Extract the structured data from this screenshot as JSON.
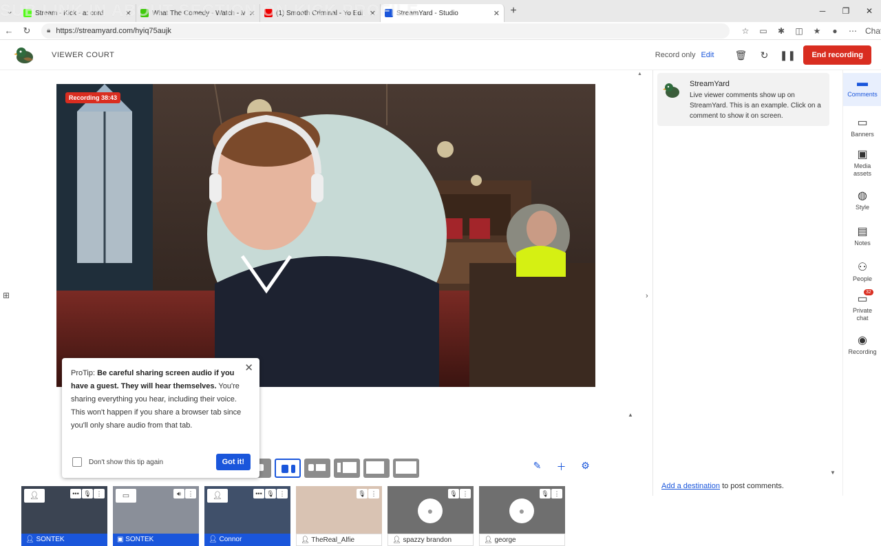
{
  "browser": {
    "tabs": [
      {
        "title": "Stream - Kick - a: cord",
        "color": "#53fc18"
      },
      {
        "title": "What The Comedy - Watch - Me",
        "color": "#3ec90a"
      },
      {
        "title": "(1) Smooth Criminal - Yo Edi",
        "color": "#e00"
      },
      {
        "title": "StreamYard - Studio",
        "color": "#1a56db",
        "active": true
      }
    ],
    "new_tab": "+",
    "url": "https://streamyard.com/hyiq75aujk",
    "chat_label": "Chat",
    "overlay_text": "SUB LINK IN ABOUT SECTION ON KICK PROFILE"
  },
  "header": {
    "studio_name": "VIEWER COURT",
    "record_only": "Record only",
    "edit": "Edit",
    "end_recording": "End recording"
  },
  "stage": {
    "recording_badge": "Recording 38:43"
  },
  "protip": {
    "prefix": "ProTip: ",
    "bold": "Be careful sharing screen audio if you have a guest. They will hear themselves.",
    "body": " You're sharing everything you hear, including their voice. This won't happen if you share a browser tab since you'll only share audio from that tab.",
    "checkbox_label": "Don't show this tip again",
    "button": "Got it!"
  },
  "tiles": [
    {
      "name": "SONTEK",
      "on_stage": true,
      "kind": "camera"
    },
    {
      "name": "SONTEK",
      "on_stage": true,
      "kind": "screen"
    },
    {
      "name": "Connor",
      "on_stage": true,
      "kind": "camera"
    },
    {
      "name": "TheReal_Alfie",
      "on_stage": false,
      "kind": "camera"
    },
    {
      "name": "spazzy brandon",
      "on_stage": false,
      "kind": "avatar"
    },
    {
      "name": "george",
      "on_stage": false,
      "kind": "avatar"
    }
  ],
  "comments": {
    "author": "StreamYard",
    "text": "Live viewer comments show up on StreamYard. This is an example. Click on a comment to show it on screen.",
    "footer_link": "Add a destination",
    "footer_text": " to post comments."
  },
  "rail": [
    {
      "label": "Comments",
      "icon": "comment-icon",
      "glyph": "▬",
      "active": true
    },
    {
      "label": "Banners",
      "icon": "banner-icon",
      "glyph": "▭"
    },
    {
      "label": "Media assets",
      "icon": "media-icon",
      "glyph": "▣"
    },
    {
      "label": "Style",
      "icon": "palette-icon",
      "glyph": "◍"
    },
    {
      "label": "Notes",
      "icon": "notes-icon",
      "glyph": "▤"
    },
    {
      "label": "People",
      "icon": "people-icon",
      "glyph": "⚇"
    },
    {
      "label": "Private chat",
      "icon": "private-chat-icon",
      "glyph": "▭",
      "badge": "32"
    },
    {
      "label": "Recording",
      "icon": "recording-icon",
      "glyph": "◉"
    }
  ],
  "colors": {
    "accent": "#1a56db",
    "danger": "#d92d20"
  }
}
